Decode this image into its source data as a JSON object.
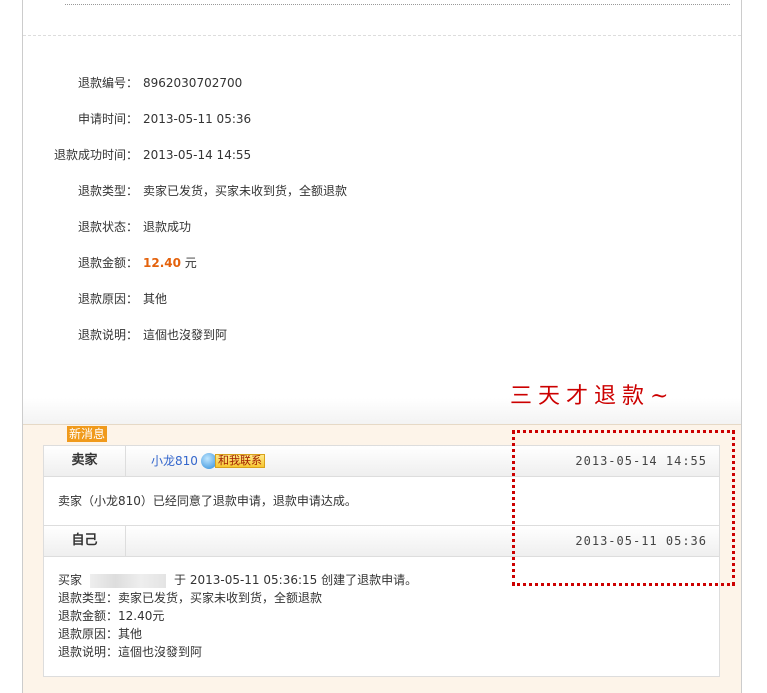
{
  "details": [
    {
      "label": "退款编号：",
      "value": "8962030702700"
    },
    {
      "label": "申请时间：",
      "value": "2013-05-11 05:36"
    },
    {
      "label": "退款成功时间：",
      "value": "2013-05-14 14:55"
    },
    {
      "label": "退款类型：",
      "value": "卖家已发货，买家未收到货，全额退款"
    },
    {
      "label": "退款状态：",
      "value": "退款成功"
    },
    {
      "label": "退款金额：",
      "value": "12.40",
      "unit": "元"
    },
    {
      "label": "退款原因：",
      "value": "其他"
    },
    {
      "label": "退款说明：",
      "value": "這個也沒發到阿"
    }
  ],
  "annotation": "三天才退款~",
  "new_tag": "新消息",
  "messages": [
    {
      "who": "卖家",
      "nick": "小龙810",
      "contact": "和我联系",
      "time": "2013-05-14  14:55",
      "body": "卖家（小龙810）已经同意了退款申请，退款申请达成。"
    },
    {
      "who": "自己",
      "time": "2013-05-11  05:36",
      "line1_prefix": "买家",
      "line1_suffix": "于 2013-05-11 05:36:15 创建了退款申请。",
      "lines": [
        "退款类型：卖家已发货，买家未收到货，全额退款",
        "退款金额：12.40元",
        "退款原因：其他",
        "退款说明：這個也沒發到阿"
      ]
    }
  ],
  "colors": {
    "accent": "#e4620c",
    "annotation": "#cc0000",
    "tag": "#f09a1c"
  }
}
